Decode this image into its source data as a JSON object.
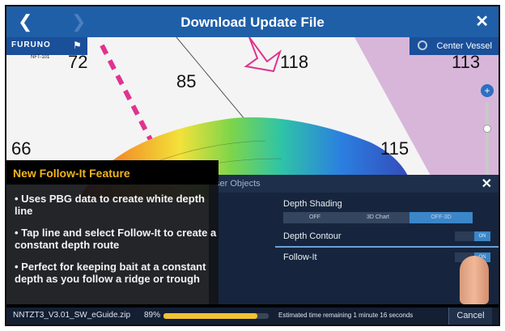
{
  "header": {
    "title": "Download Update File",
    "back_icon": "chevron-left-icon",
    "forward_icon": "chevron-right-icon",
    "close_icon": "close-icon"
  },
  "map": {
    "brand_logo": "FURUNO",
    "brand_sub": "NFT-101",
    "center_vessel_label": "Center Vessel",
    "depths": [
      "72",
      "85",
      "118",
      "113",
      "66",
      "115"
    ]
  },
  "layer_dialog": {
    "title": "ser Objects",
    "depth_shading_label": "Depth Shading",
    "depth_shading_options": [
      "OFF",
      "3D Chart",
      "OFF-3D"
    ],
    "depth_contour_label": "Depth Contour",
    "follow_it_label": "Follow-It",
    "toggle_on_text": "ON"
  },
  "feature_panel": {
    "title": "New Follow-It Feature",
    "bullets": [
      "• Uses PBG data to create white depth line",
      "• Tap line and select Follow-It to create a constant depth route",
      "• Perfect for keeping bait at a constant depth as you follow a ridge or trough"
    ]
  },
  "status": {
    "filename": "NNTZT3_V3.01_SW_eGuide.zip",
    "percent": "89%",
    "progress": 0.89,
    "eta": "Estimated time remaining 1 minute 16 seconds",
    "cancel_label": "Cancel"
  },
  "colors": {
    "title_bar": "#1f5fa8",
    "accent_title": "#f2b51a",
    "progress_fill": "#f1c232",
    "route_pink": "#e0338f"
  }
}
